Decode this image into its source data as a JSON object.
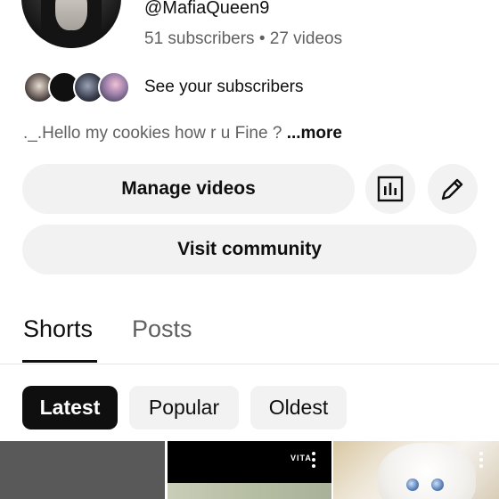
{
  "profile": {
    "handle": "@MafiaQueen9",
    "stats": "51 subscribers • 27 videos",
    "description": "._.Hello my cookies how r u Fine ? ",
    "more_label": "...more"
  },
  "subscribers": {
    "label": "See your subscribers"
  },
  "actions": {
    "manage_videos": "Manage videos",
    "visit_community": "Visit community",
    "analytics_icon": "analytics-icon",
    "edit_icon": "pencil-icon"
  },
  "tabs": [
    {
      "label": "Shorts",
      "selected": true
    },
    {
      "label": "Posts",
      "selected": false
    }
  ],
  "chips": [
    {
      "label": "Latest",
      "selected": true
    },
    {
      "label": "Popular",
      "selected": false
    },
    {
      "label": "Oldest",
      "selected": false
    }
  ],
  "thumbnails": {
    "watermark": "VITA"
  },
  "colors": {
    "text_primary": "#0f0f0f",
    "text_secondary": "#606060",
    "button_bg": "#f2f2f2",
    "chip_selected_bg": "#0f0f0f"
  }
}
